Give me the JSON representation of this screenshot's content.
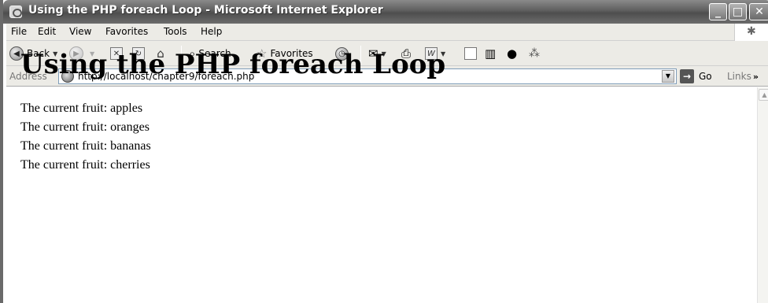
{
  "window": {
    "title": "Using the PHP foreach Loop - Microsoft Internet Explorer",
    "controls": {
      "minimize": "_",
      "maximize": "□",
      "close": "✕"
    }
  },
  "menubar": {
    "items": [
      "File",
      "Edit",
      "View",
      "Favorites",
      "Tools",
      "Help"
    ]
  },
  "toolbar": {
    "back_label": "Back",
    "search_label": "Search",
    "favorites_label": "Favorites"
  },
  "addressbar": {
    "label": "Address",
    "url": "http://localhost/chapter9/foreach.php",
    "go_label": "Go",
    "links_label": "Links"
  },
  "page": {
    "heading": "Using the PHP foreach Loop",
    "lines": [
      "The current fruit: apples",
      "The current fruit: oranges",
      "The current fruit: bananas",
      "The current fruit: cherries"
    ]
  }
}
